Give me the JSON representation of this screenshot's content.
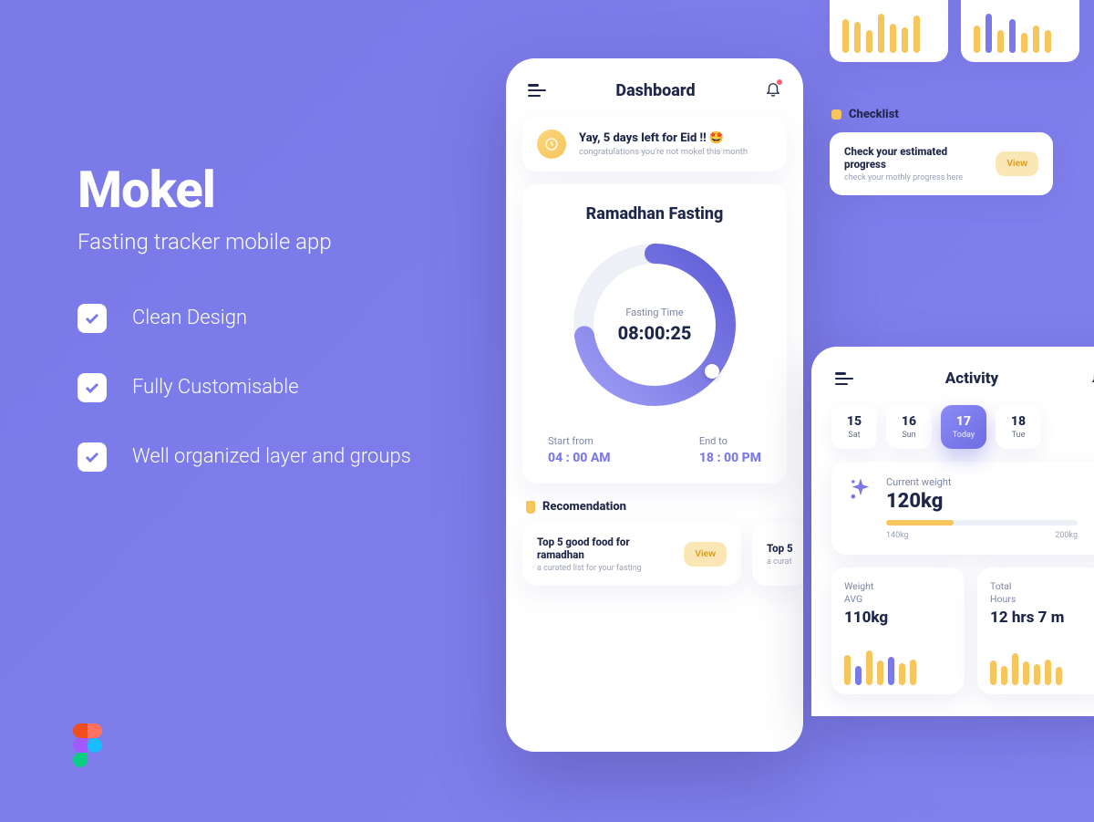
{
  "marketing": {
    "title": "Mokel",
    "subtitle": "Fasting tracker mobile app",
    "features": [
      "Clean Design",
      "Fully Customisable",
      "Well organized layer and groups"
    ]
  },
  "dashboard": {
    "title": "Dashboard",
    "alert": {
      "title": "Yay, 5 days left for Eid !! 🤩",
      "sub": "congratulations you're not mokel this month"
    },
    "ring": {
      "title": "Ramadhan Fasting",
      "label": "Fasting Time",
      "time": "08:00:25",
      "start_label": "Start from",
      "start_val": "04 : 00 AM",
      "end_label": "End to",
      "end_val": "18 : 00 PM"
    },
    "rec_header": "Recomendation",
    "recs": [
      {
        "title": "Top 5 good food for ramadhan",
        "sub": "a curated list for your fasting",
        "btn": "View"
      },
      {
        "title": "Top 5",
        "sub": "a curat"
      }
    ]
  },
  "checklist": {
    "header": "Checklist",
    "items": [
      {
        "title": "Check your estimated progress",
        "sub": "check your mothly progress here",
        "btn": "View"
      }
    ]
  },
  "activity": {
    "title": "Activity",
    "dates": [
      {
        "num": "15",
        "day": "Sat"
      },
      {
        "num": "16",
        "day": "Sun"
      },
      {
        "num": "17",
        "day": "Today",
        "active": true
      },
      {
        "num": "18",
        "day": "Tue"
      }
    ],
    "weight": {
      "label": "Current weight",
      "value": "120kg",
      "min": "140kg",
      "max": "200kg"
    },
    "stats": [
      {
        "label": "Weight\nAVG",
        "value": "110kg"
      },
      {
        "label": "Total\nHours",
        "value": "12 hrs 7 m"
      }
    ]
  },
  "chart_data": [
    {
      "type": "bar",
      "title": "mini-1",
      "values": [
        60,
        55,
        40,
        70,
        52,
        45,
        66
      ],
      "colors": [
        "y",
        "y",
        "y",
        "y",
        "y",
        "y",
        "y"
      ]
    },
    {
      "type": "bar",
      "title": "mini-2",
      "values": [
        48,
        70,
        40,
        60,
        35,
        48,
        40
      ],
      "colors": [
        "y",
        "p",
        "y",
        "p",
        "y",
        "y",
        "y"
      ]
    },
    {
      "type": "bar",
      "title": "weight-avg",
      "values": [
        62,
        40,
        70,
        50,
        58,
        45,
        52
      ],
      "colors": [
        "y",
        "p",
        "y",
        "y",
        "p",
        "y",
        "y"
      ]
    },
    {
      "type": "bar",
      "title": "total-hours",
      "values": [
        50,
        40,
        66,
        48,
        44,
        52,
        38
      ],
      "colors": [
        "y",
        "y",
        "y",
        "y",
        "y",
        "y",
        "y"
      ]
    }
  ]
}
